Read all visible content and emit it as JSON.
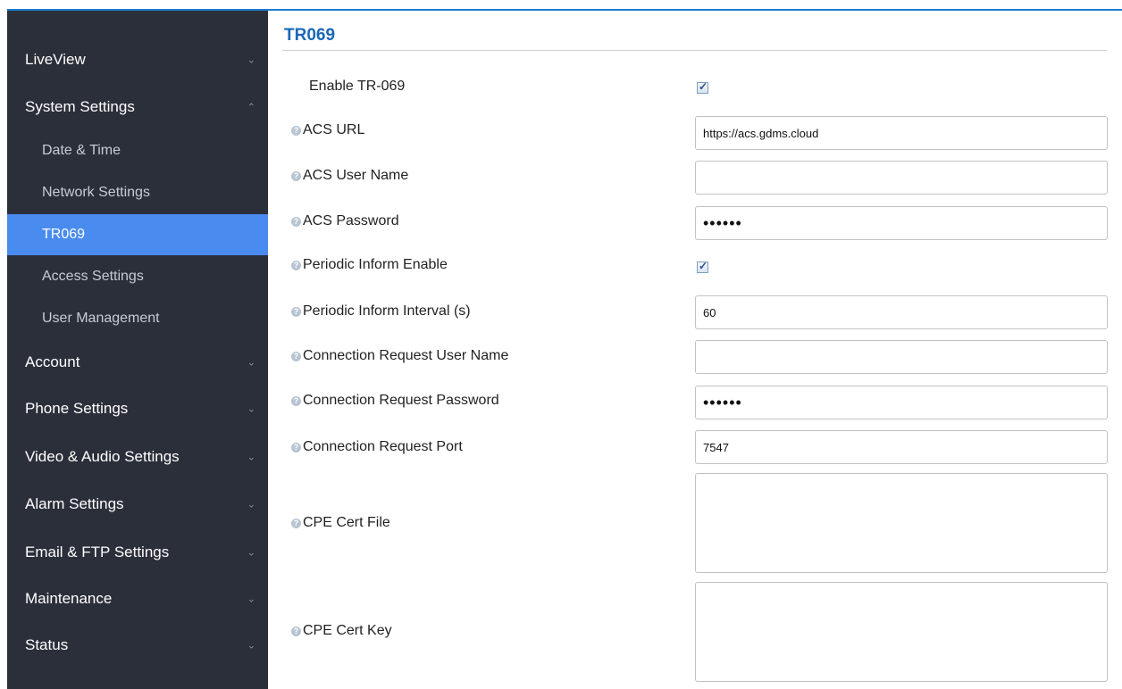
{
  "sidebar": {
    "items": [
      {
        "label": "LiveView",
        "chevron": "chevron-down"
      },
      {
        "label": "System Settings",
        "chevron": "chevron-up"
      },
      {
        "label": "Account",
        "chevron": "chevron-down"
      },
      {
        "label": "Phone Settings",
        "chevron": "chevron-down"
      },
      {
        "label": "Video & Audio Settings",
        "chevron": "chevron-down"
      },
      {
        "label": "Alarm Settings",
        "chevron": "chevron-down"
      },
      {
        "label": "Email & FTP Settings",
        "chevron": "chevron-down"
      },
      {
        "label": "Maintenance",
        "chevron": "chevron-down"
      },
      {
        "label": "Status",
        "chevron": "chevron-down"
      }
    ],
    "subitems": [
      {
        "label": "Date & Time"
      },
      {
        "label": "Network Settings"
      },
      {
        "label": "TR069",
        "active": true
      },
      {
        "label": "Access Settings"
      },
      {
        "label": "User Management"
      }
    ]
  },
  "page": {
    "title": "TR069"
  },
  "form": {
    "enable_tr069": {
      "label": "Enable TR-069",
      "checked": true
    },
    "acs_url": {
      "label": "ACS URL",
      "value": "https://acs.gdms.cloud"
    },
    "acs_user_name": {
      "label": "ACS User Name",
      "value": ""
    },
    "acs_password": {
      "label": "ACS Password",
      "value": "••••••"
    },
    "periodic_inform_enable": {
      "label": "Periodic Inform Enable",
      "checked": true
    },
    "periodic_inform_interval": {
      "label": "Periodic Inform Interval (s)",
      "value": "60"
    },
    "connection_request_user_name": {
      "label": "Connection Request User Name",
      "value": ""
    },
    "connection_request_password": {
      "label": "Connection Request Password",
      "value": "••••••"
    },
    "connection_request_port": {
      "label": "Connection Request Port",
      "value": "7547"
    },
    "cpe_cert_file": {
      "label": "CPE Cert File",
      "value": ""
    },
    "cpe_cert_key": {
      "label": "CPE Cert Key",
      "value": ""
    }
  },
  "icons": {
    "help": "help-icon",
    "checkmark": "✓"
  },
  "colors": {
    "sidebar_bg": "#2b2f3a",
    "active_item": "#4a8bf0",
    "title": "#1a67b8"
  }
}
